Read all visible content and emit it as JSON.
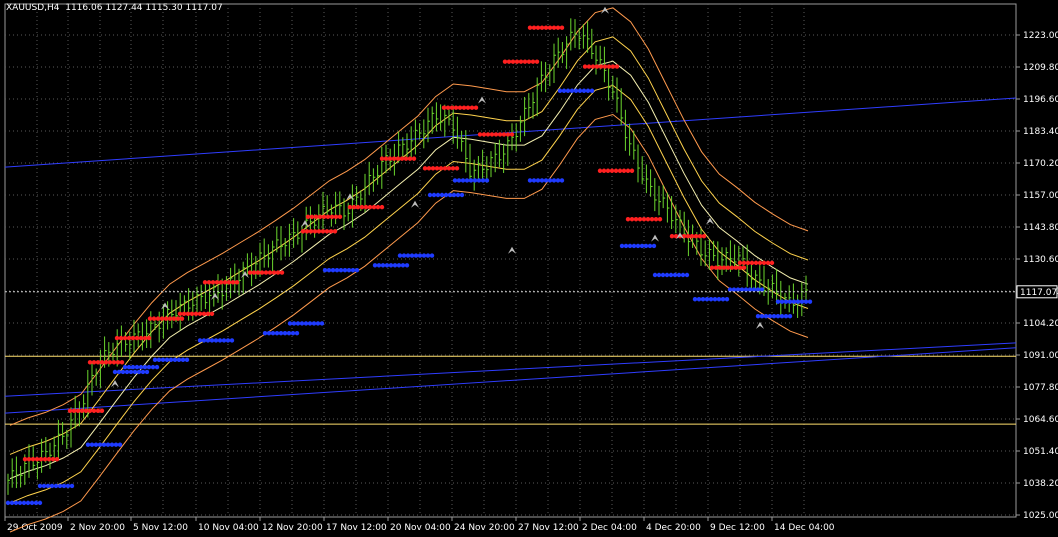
{
  "header": {
    "symbol": "XAUUSD,H4",
    "ohlc": "1116.06 1127.44 1115.30 1117.07"
  },
  "colors": {
    "background": "#000000",
    "grid": "#5a5a5a",
    "bars": "#6bd62e",
    "stop_up": "#ff2020",
    "stop_down": "#1f3bff",
    "trendline": "#2f3dff",
    "hline": "#ffdf6e",
    "band_outer": "#ff9a4d",
    "band_inner": "#ffd34d",
    "band_mid": "#f5f0b0",
    "price_label_bg": "#000000",
    "text": "#ffffff"
  },
  "chart_data": {
    "type": "line",
    "title": "",
    "ylim": [
      1025.0,
      1236.2
    ],
    "y_ticks": [
      "1223.00",
      "1209.80",
      "1196.60",
      "1183.40",
      "1170.20",
      "1157.00",
      "1143.80",
      "1130.60",
      "1117.40",
      "1104.20",
      "1091.00",
      "1077.80",
      "1064.60",
      "1051.40",
      "1038.20",
      "1025.00"
    ],
    "x_ticks": [
      "29 Oct 2009",
      "2 Nov 20:00",
      "5 Nov 12:00",
      "10 Nov 04:00",
      "12 Nov 20:00",
      "17 Nov 12:00",
      "20 Nov 04:00",
      "24 Nov 20:00",
      "27 Nov 12:00",
      "2 Dec 04:00",
      "4 Dec 20:00",
      "9 Dec 12:00",
      "14 Dec 04:00"
    ],
    "current_price": "1117.07",
    "series": [
      {
        "values": [
          1040,
          1046,
          1050,
          1058,
          1070,
          1088,
          1095,
          1098,
          1102,
          1108,
          1112,
          1115,
          1118,
          1124,
          1130,
          1136,
          1140,
          1146,
          1152,
          1150,
          1160,
          1170,
          1176,
          1182,
          1190,
          1186,
          1166,
          1170,
          1176,
          1190,
          1205,
          1216,
          1225,
          1215,
          1200,
          1176,
          1160,
          1152,
          1142,
          1134,
          1130,
          1132,
          1122,
          1118,
          1112,
          1117
        ]
      }
    ],
    "stops_red": [
      [
        1048.0,
        1048.0
      ],
      [
        1068.0,
        1068.0
      ],
      [
        1088.0,
        1088.0
      ],
      [
        1098.0,
        1098.0
      ],
      [
        1106.0,
        1106.0
      ],
      [
        1108.0,
        1108.0
      ],
      [
        1121.0,
        1121.0
      ],
      [
        1125.0,
        1125.0
      ],
      [
        1142.0,
        1142.0
      ],
      [
        1148.0,
        1148.0
      ],
      [
        1152.0,
        1152.0
      ],
      [
        1172.0,
        1172.0
      ],
      [
        1168.0,
        1168.0
      ],
      [
        1193.0,
        1193.0
      ],
      [
        1182.0,
        1182.0
      ],
      [
        1212.0,
        1212.0
      ],
      [
        1226.0,
        1226.0
      ],
      [
        1210.0,
        1210.0
      ],
      [
        1167.0,
        1167.0
      ],
      [
        1147.0,
        1147.0
      ],
      [
        1140.0,
        1140.0
      ],
      [
        1127.0,
        1127.0
      ],
      [
        1129.0,
        1129.0
      ]
    ],
    "stops_blue": [
      [
        1030.0,
        1030.0
      ],
      [
        1037.0,
        1037.0
      ],
      [
        1054.0,
        1054.0
      ],
      [
        1084.0,
        1084.0
      ],
      [
        1086.0,
        1086.0
      ],
      [
        1089.0,
        1089.0
      ],
      [
        1097.0,
        1097.0
      ],
      [
        1100.0,
        1100.0
      ],
      [
        1104.0,
        1104.0
      ],
      [
        1126.0,
        1126.0
      ],
      [
        1128.0,
        1128.0
      ],
      [
        1132.0,
        1132.0
      ],
      [
        1157.0,
        1157.0
      ],
      [
        1163.0,
        1163.0
      ],
      [
        1163.0,
        1163.0
      ],
      [
        1200.0,
        1200.0
      ],
      [
        1136.0,
        1136.0
      ],
      [
        1124.0,
        1124.0
      ],
      [
        1114.0,
        1114.0
      ],
      [
        1118.0,
        1118.0
      ],
      [
        1107.0,
        1107.0
      ],
      [
        1113.0,
        1113.0
      ]
    ],
    "hlines": [
      1090.5,
      1062.5
    ]
  }
}
